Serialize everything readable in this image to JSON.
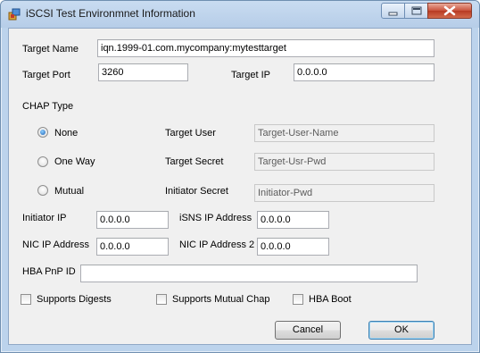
{
  "window": {
    "title": "iSCSI Test Environmnet Information"
  },
  "form": {
    "target_name": {
      "label": "Target Name",
      "value": "iqn.1999-01.com.mycompany:mytesttarget"
    },
    "target_port": {
      "label": "Target Port",
      "value": "3260"
    },
    "target_ip": {
      "label": "Target IP",
      "value": "0.0.0.0"
    },
    "chap": {
      "section_label": "CHAP Type",
      "options": [
        {
          "label": "None",
          "checked": true
        },
        {
          "label": "One Way",
          "checked": false
        },
        {
          "label": "Mutual",
          "checked": false
        }
      ],
      "target_user": {
        "label": "Target User",
        "value": "Target-User-Name"
      },
      "target_secret": {
        "label": "Target Secret",
        "value": "Target-Usr-Pwd"
      },
      "initiator_secret": {
        "label": "Initiator Secret",
        "value": "Initiator-Pwd"
      }
    },
    "initiator_ip": {
      "label": "Initiator IP",
      "value": "0.0.0.0"
    },
    "isns_ip": {
      "label": "iSNS IP Address",
      "value": "0.0.0.0"
    },
    "nic_ip": {
      "label": "NIC IP Address",
      "value": "0.0.0.0"
    },
    "nic_ip2": {
      "label": "NIC IP Address 2",
      "value": "0.0.0.0"
    },
    "hba_pnp_id": {
      "label": "HBA PnP ID",
      "value": ""
    },
    "checkboxes": [
      {
        "label": "Supports Digests",
        "checked": false
      },
      {
        "label": "Supports Mutual Chap",
        "checked": false
      },
      {
        "label": "HBA Boot",
        "checked": false
      }
    ]
  },
  "buttons": {
    "cancel": "Cancel",
    "ok": "OK"
  }
}
